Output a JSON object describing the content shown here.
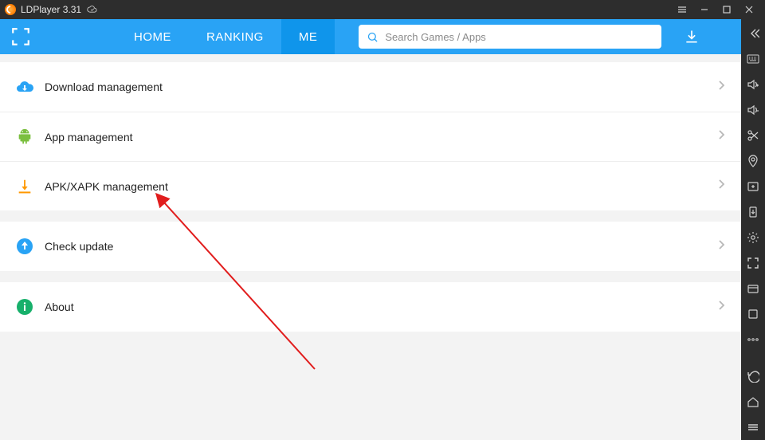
{
  "title": "LDPlayer 3.31",
  "nav": {
    "tabs": [
      "HOME",
      "RANKING",
      "ME"
    ],
    "active_index": 2,
    "search_placeholder": "Search Games / Apps"
  },
  "menu": {
    "groups": [
      {
        "items": [
          {
            "id": "download-management",
            "label": "Download management",
            "icon": "cloud-download"
          },
          {
            "id": "app-management",
            "label": "App management",
            "icon": "android"
          },
          {
            "id": "apk-management",
            "label": "APK/XAPK management",
            "icon": "apk-download"
          }
        ]
      },
      {
        "items": [
          {
            "id": "check-update",
            "label": "Check update",
            "icon": "arrow-up-circle"
          }
        ]
      },
      {
        "items": [
          {
            "id": "about",
            "label": "About",
            "icon": "info"
          }
        ]
      }
    ]
  },
  "sidebar_icons": [
    "collapse",
    "keyboard",
    "volume-up",
    "volume-down",
    "scissors",
    "location",
    "add-window",
    "install-apk",
    "settings",
    "fullscreen",
    "multi-window",
    "rotate",
    "more"
  ],
  "sidebar_bottom": [
    "back",
    "home",
    "recent"
  ],
  "colors": {
    "accent": "#29a3f5",
    "accent_dark": "#0f95eb",
    "sidebar": "#2d2d2d",
    "arrow": "#e11d1d"
  }
}
